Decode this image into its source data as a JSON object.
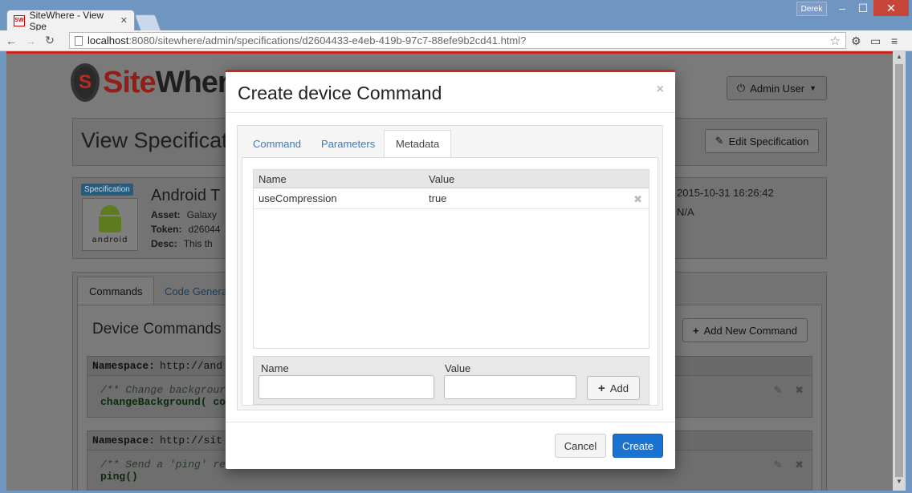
{
  "browser": {
    "tab_title": "SiteWhere - View Spe",
    "tab_favicon_text": "SW",
    "profile_name": "Derek",
    "url_host": "localhost",
    "url_rest": ":8080/sitewhere/admin/specifications/d2604433-e4eb-419b-97c7-88efe9b2cd41.html?"
  },
  "header": {
    "logo_site": "Site",
    "logo_where": "Wher",
    "admin_button": "Admin User"
  },
  "view": {
    "title": "View Specificat",
    "edit_button": "Edit Specification"
  },
  "specification": {
    "badge": "Specification",
    "platform_word": "android",
    "name": "Android T",
    "asset_label": "Asset:",
    "asset_value": "Galaxy",
    "token_label": "Token:",
    "token_value": "d26044",
    "desc_label": "Desc:",
    "desc_value": "This th",
    "created_date": "2015-10-31 16:26:42",
    "updated_date": "N/A"
  },
  "bg_tabs": [
    "Commands",
    "Code Genera"
  ],
  "device_commands": {
    "title": "Device Commands",
    "add_button": "Add New Command",
    "commands": [
      {
        "namespace_label": "Namespace:",
        "namespace_value": "http://and",
        "comment": "/** Change backgrour",
        "signature": "changeBackground( co"
      },
      {
        "namespace_label": "Namespace:",
        "namespace_value": "http://sit",
        "comment": "/** Send a 'ping' re",
        "signature": "ping()"
      }
    ]
  },
  "modal": {
    "title": "Create device Command",
    "tabs": [
      "Command",
      "Parameters",
      "Metadata"
    ],
    "active_tab": "Metadata",
    "metadata": {
      "columns": [
        "Name",
        "Value"
      ],
      "rows": [
        {
          "name": "useCompression",
          "value": "true"
        }
      ],
      "add_name_label": "Name",
      "add_value_label": "Value",
      "add_name_value": "",
      "add_value_value": "",
      "add_button": "Add"
    },
    "cancel_button": "Cancel",
    "create_button": "Create"
  }
}
